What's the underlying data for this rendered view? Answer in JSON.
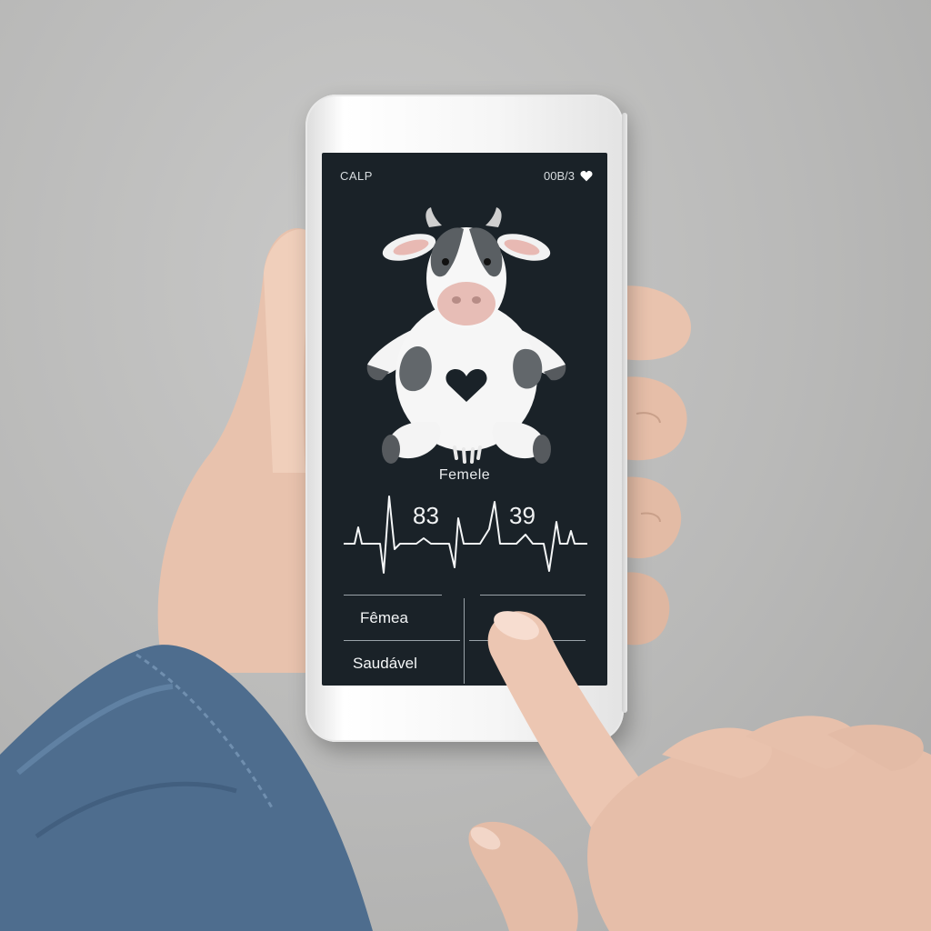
{
  "status_bar": {
    "left_text": "CALP",
    "right_text": "00B/3",
    "right_icon": "heart-icon"
  },
  "mascot": {
    "icon": "cow-icon"
  },
  "animal": {
    "sex_label": "Femele"
  },
  "readings": {
    "primary": "83",
    "secondary": "39"
  },
  "info_grid": {
    "sex_value": "Fêmea",
    "health_value": "Saudável"
  },
  "colors": {
    "screen_bg": "#1a2228",
    "text": "#f4f6f7",
    "divider": "#9aa3a9"
  }
}
